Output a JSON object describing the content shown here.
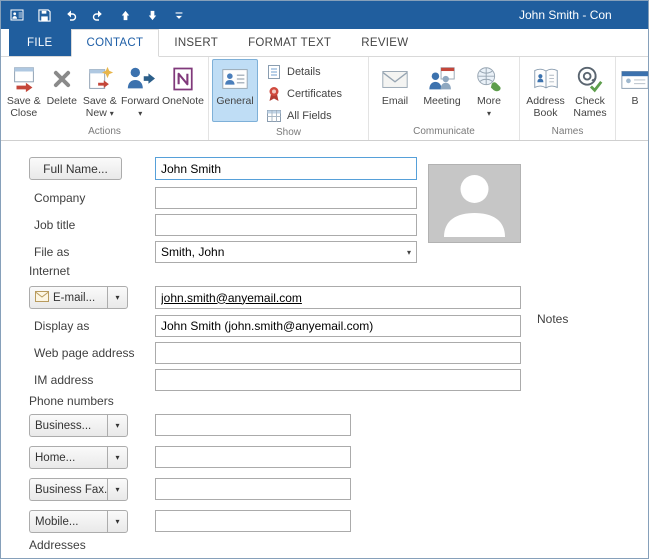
{
  "window": {
    "title": "John Smith - Con"
  },
  "colors": {
    "titlebar_blue": "#205E9E",
    "active_tab_text": "#1F5FA7",
    "selected_ribbon_button_bg": "#BFDDF5",
    "focused_input_border": "#56A0D9"
  },
  "icons": {
    "caret": "▾",
    "list": [
      "app-icon",
      "save-icon",
      "undo-icon",
      "redo-icon",
      "previous-item-icon",
      "next-item-icon",
      "qat-customize-icon",
      "save-close-icon",
      "delete-icon",
      "save-new-icon",
      "forward-icon",
      "onenote-icon",
      "general-icon",
      "details-icon",
      "certificates-icon",
      "all-fields-icon",
      "email-icon",
      "meeting-icon",
      "more-icon",
      "address-book-icon",
      "check-names-icon",
      "business-card-icon",
      "envelope-icon",
      "photo-placeholder-silhouette"
    ]
  },
  "tabs": [
    {
      "label": "FILE",
      "active": false
    },
    {
      "label": "CONTACT",
      "active": true
    },
    {
      "label": "INSERT",
      "active": false
    },
    {
      "label": "FORMAT TEXT",
      "active": false
    },
    {
      "label": "REVIEW",
      "active": false
    }
  ],
  "ribbon": {
    "actions": {
      "name": "Actions",
      "save_close": {
        "l1": "Save &",
        "l2": "Close"
      },
      "delete": "Delete",
      "save_new": {
        "l1": "Save &",
        "l2": "New"
      },
      "forward": "Forward",
      "onenote": "OneNote"
    },
    "show": {
      "name": "Show",
      "general": "General",
      "details": "Details",
      "certificates": "Certificates",
      "all_fields": "All Fields"
    },
    "communicate": {
      "name": "Communicate",
      "email": "Email",
      "meeting": "Meeting",
      "more": "More"
    },
    "names": {
      "name": "Names",
      "address_book": {
        "l1": "Address",
        "l2": "Book"
      },
      "check_names": {
        "l1": "Check",
        "l2": "Names"
      }
    },
    "partial": {
      "label": "B"
    }
  },
  "form": {
    "full_name": {
      "button": "Full Name...",
      "value": "John Smith"
    },
    "company": {
      "label": "Company",
      "value": ""
    },
    "job_title": {
      "label": "Job title",
      "value": ""
    },
    "file_as": {
      "label": "File as",
      "value": "Smith, John"
    },
    "internet_section": "Internet",
    "email": {
      "button": "E-mail...",
      "value": "john.smith@anyemail.com"
    },
    "display_as": {
      "label": "Display as",
      "value": "John Smith (john.smith@anyemail.com)"
    },
    "web_page": {
      "label": "Web page address",
      "value": ""
    },
    "im_address": {
      "label": "IM address",
      "value": ""
    },
    "notes_label": "Notes",
    "phone_section": "Phone numbers",
    "phones": [
      {
        "button": "Business...",
        "value": ""
      },
      {
        "button": "Home...",
        "value": ""
      },
      {
        "button": "Business Fax...",
        "value": ""
      },
      {
        "button": "Mobile...",
        "value": ""
      }
    ],
    "addresses_section": "Addresses"
  }
}
